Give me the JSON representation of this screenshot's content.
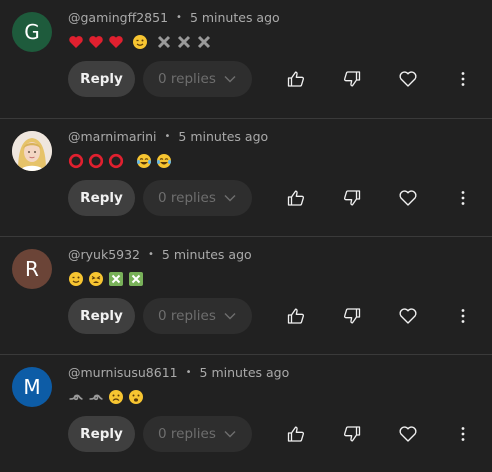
{
  "colors": {
    "background": "#212121",
    "reply_button_bg": "#3f3f3f",
    "replies_button_bg": "#2e2e2e",
    "meta_text": "#aaaaaa"
  },
  "comments": [
    {
      "username": "@gamingff2851",
      "time": "5 minutes ago",
      "avatar": {
        "type": "letter",
        "letter": "G",
        "color": "#1e5b3c"
      },
      "emojis": [
        "red-heart",
        "red-heart",
        "red-heart",
        "winking-face",
        "heavy-multiplication-x",
        "heavy-multiplication-x",
        "heavy-multiplication-x"
      ],
      "reply_label": "Reply",
      "replies_label": "0 replies"
    },
    {
      "username": "@marnimarini",
      "time": "5 minutes ago",
      "avatar": {
        "type": "photo"
      },
      "emojis": [
        "hollow-red-circle",
        "hollow-red-circle",
        "hollow-red-circle",
        "face-with-tears-of-joy",
        "face-with-tears-of-joy"
      ],
      "reply_label": "Reply",
      "replies_label": "0 replies"
    },
    {
      "username": "@ryuk5932",
      "time": "5 minutes ago",
      "avatar": {
        "type": "letter",
        "letter": "R",
        "color": "#6b4437"
      },
      "emojis": [
        "winking-face",
        "tired-face",
        "cross-mark-button",
        "cross-mark-button"
      ],
      "reply_label": "Reply",
      "replies_label": "0 replies"
    },
    {
      "username": "@murnisusu8611",
      "time": "5 minutes ago",
      "avatar": {
        "type": "letter",
        "letter": "M",
        "color": "#0d5ca6"
      },
      "emojis": [
        "curly-loop",
        "curly-loop",
        "frowning-face",
        "anguished-face"
      ],
      "reply_label": "Reply",
      "replies_label": "0 replies"
    }
  ]
}
